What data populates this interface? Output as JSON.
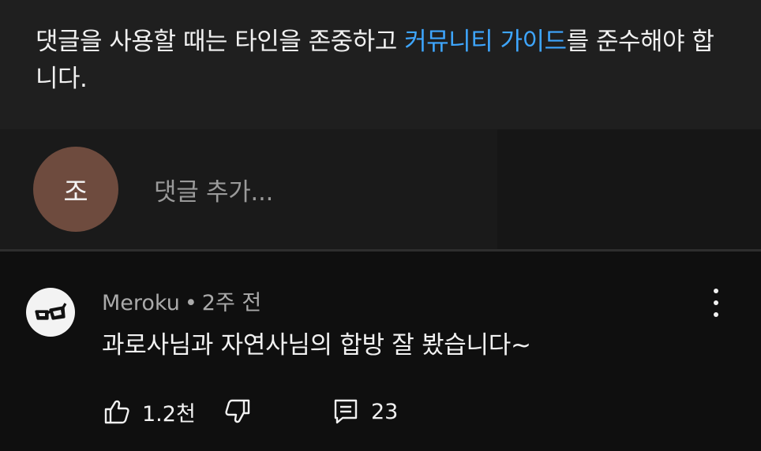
{
  "notice": {
    "text_before": "댓글을 사용할 때는 타인을 존중하고 ",
    "link_label": "커뮤니티 가이드",
    "text_after": "를 준수해야 합니다."
  },
  "add_comment": {
    "avatar_initial": "조",
    "placeholder": "댓글 추가..."
  },
  "comment": {
    "author": "Meroku",
    "separator": "•",
    "time": "2주 전",
    "text": "과로사님과 자연사님의 합방 잘 봤습니다~",
    "like_count": "1.2천",
    "reply_count": "23",
    "avatar_icon": "glasses-icon"
  },
  "colors": {
    "link": "#3ea6ff",
    "self_avatar": "#6e4b3e",
    "background": "#0f0f0f"
  }
}
